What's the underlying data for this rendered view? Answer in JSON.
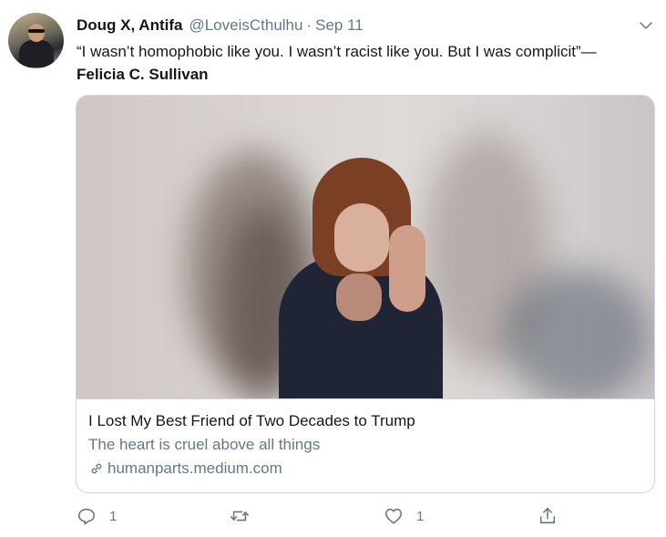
{
  "tweet": {
    "author": {
      "display_name": "Doug X, Antifa",
      "handle": "@LoveisCthulhu",
      "separator": "·",
      "date": "Sep 11"
    },
    "text": {
      "quote": "“I wasn’t homophobic like you. I wasn’t racist like you. But I was complicit”—",
      "attribution": "Felicia C. Sullivan"
    },
    "card": {
      "title": "I Lost My Best Friend of Two Decades to Trump",
      "description": "The heart is cruel above all things",
      "domain": "humanparts.medium.com"
    },
    "actions": {
      "reply_count": "1",
      "retweet_count": "",
      "like_count": "1"
    }
  },
  "icons": {
    "menu": "chevron-down-icon",
    "reply": "reply-icon",
    "retweet": "retweet-icon",
    "like": "heart-icon",
    "share": "share-icon",
    "link": "link-icon"
  },
  "colors": {
    "text": "#14171a",
    "secondary": "#657786",
    "border": "#ccd6dd"
  }
}
